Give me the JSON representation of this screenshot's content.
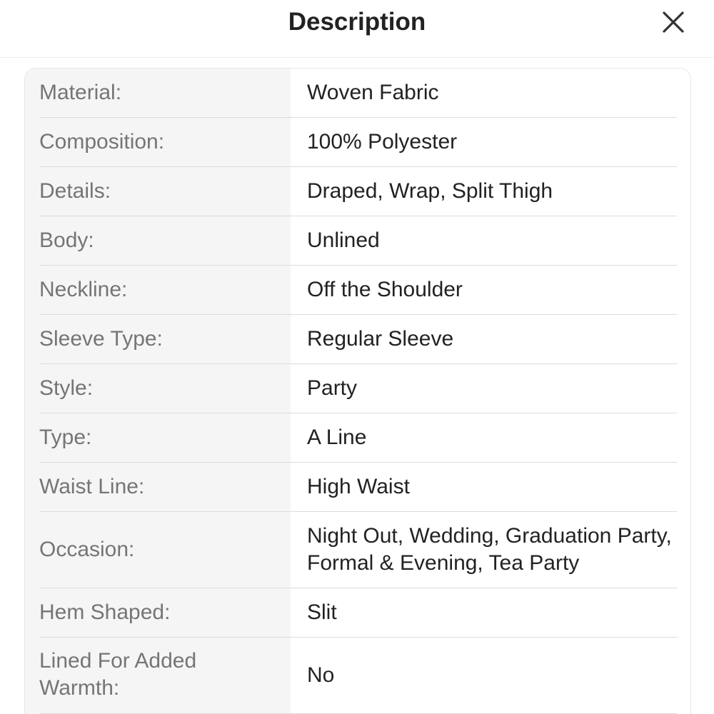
{
  "header": {
    "title": "Description"
  },
  "attributes": [
    {
      "label": "Material:",
      "value": "Woven Fabric"
    },
    {
      "label": "Composition:",
      "value": "100% Polyester"
    },
    {
      "label": "Details:",
      "value": "Draped, Wrap, Split Thigh"
    },
    {
      "label": "Body:",
      "value": "Unlined"
    },
    {
      "label": "Neckline:",
      "value": "Off the Shoulder"
    },
    {
      "label": "Sleeve Type:",
      "value": "Regular Sleeve"
    },
    {
      "label": "Style:",
      "value": "Party"
    },
    {
      "label": "Type:",
      "value": "A Line"
    },
    {
      "label": "Waist Line:",
      "value": "High Waist"
    },
    {
      "label": "Occasion:",
      "value": "Night Out, Wedding, Graduation Party, Formal & Evening, Tea Party"
    },
    {
      "label": "Hem Shaped:",
      "value": "Slit"
    },
    {
      "label": "Lined For Added Warmth:",
      "value": "No"
    }
  ]
}
